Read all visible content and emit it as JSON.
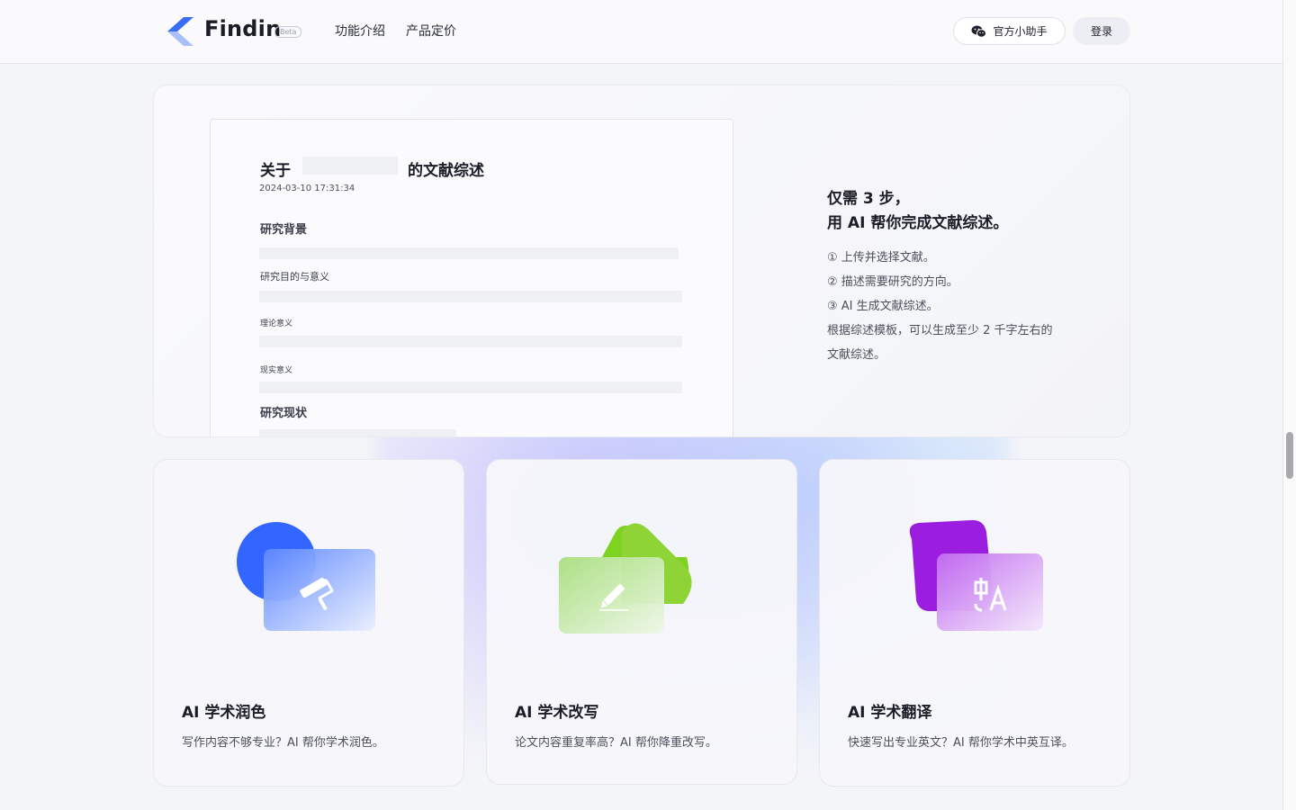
{
  "header": {
    "brand": "Findin",
    "badge": "Beta",
    "nav": [
      "功能介绍",
      "产品定价"
    ],
    "helper_button": "官方小助手",
    "login_button": "登录"
  },
  "doc_preview": {
    "title_prefix": "关于",
    "title_suffix": "的文献综述",
    "date": "2024-03-10 17:31:34",
    "sections": {
      "background": "研究背景",
      "purpose": "研究目的与意义",
      "theory": "理论意义",
      "practice": "现实意义",
      "status": "研究现状"
    }
  },
  "intro": {
    "title_line1": "仅需 3 步，",
    "title_line2": "用 AI 帮你完成文献综述。",
    "step1": "① 上传并选择文献。",
    "step2": "② 描述需要研究的方向。",
    "step3": "③ AI 生成文献综述。",
    "note_line1": "根据综述模板，可以生成至少 2 千字左右的",
    "note_line2": "文献综述。"
  },
  "features": [
    {
      "title": "AI 学术润色",
      "desc": "写作内容不够专业？AI 帮你学术润色。",
      "icon": "paint-roller-icon",
      "color": "#3366ff"
    },
    {
      "title": "AI 学术改写",
      "desc": "论文内容重复率高？AI 帮你降重改写。",
      "icon": "pencil-icon",
      "color": "#7ed321"
    },
    {
      "title": "AI 学术翻译",
      "desc": "快速写出专业英文？AI 帮你学术中英互译。",
      "icon": "translate-icon",
      "color": "#9b1ee0"
    }
  ]
}
